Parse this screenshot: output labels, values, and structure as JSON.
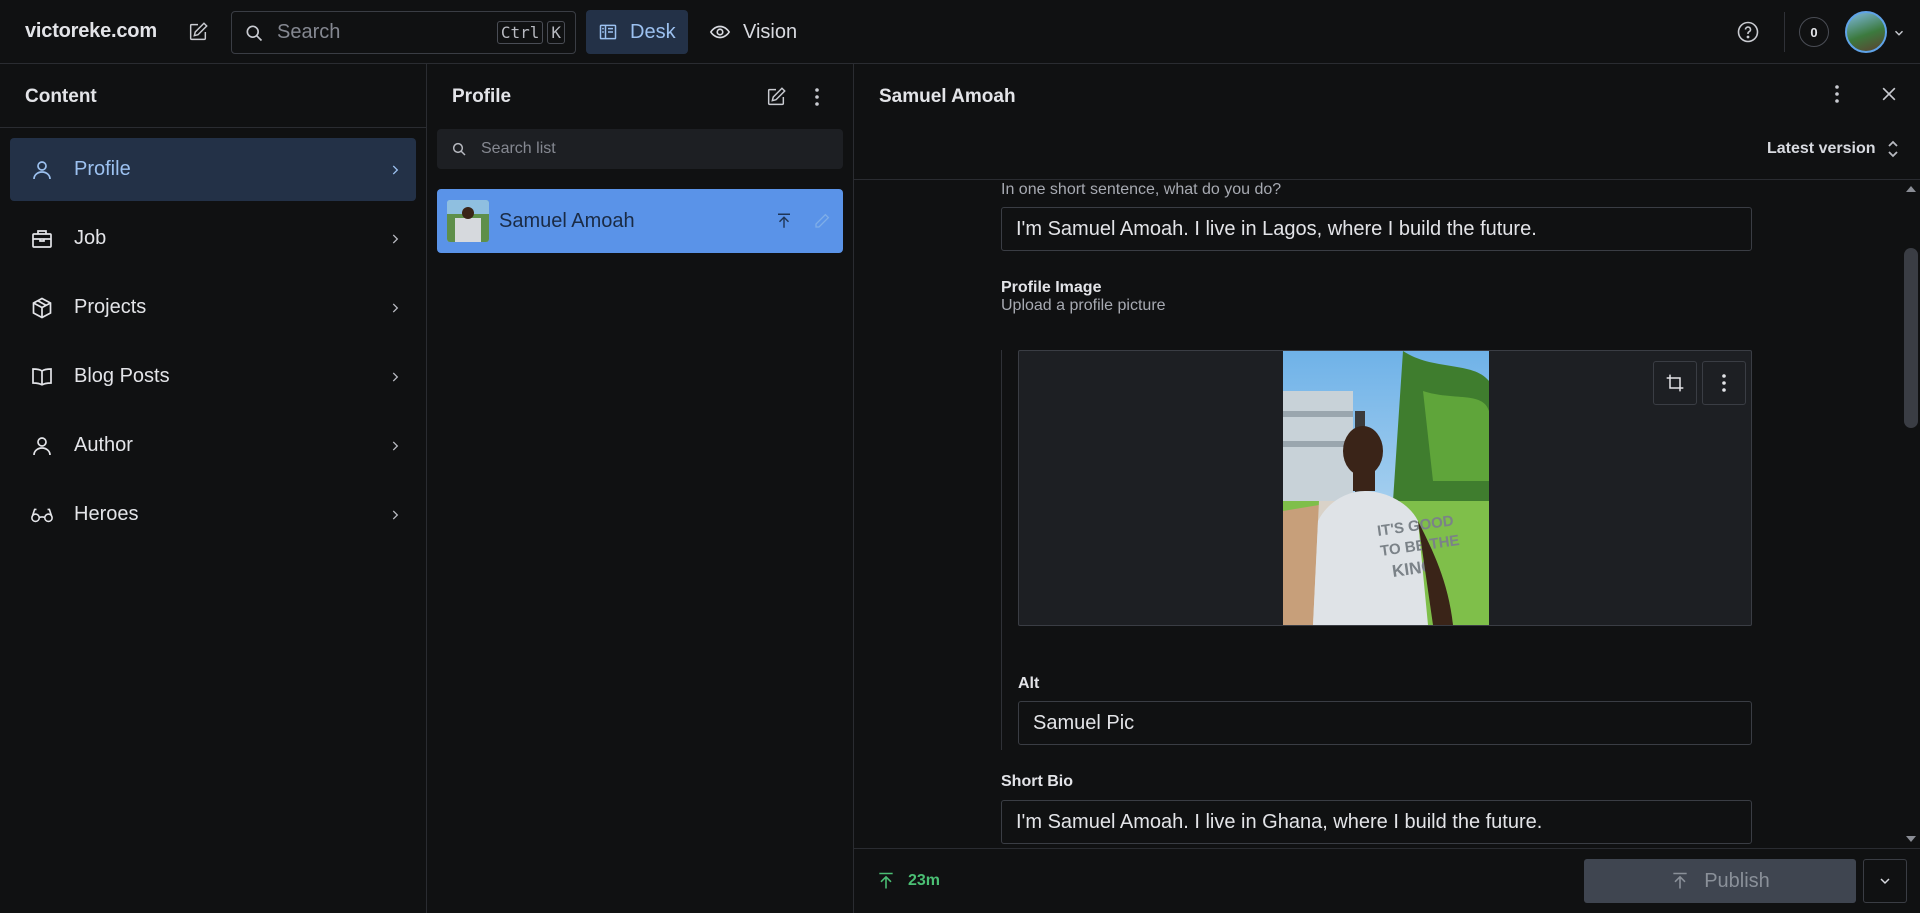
{
  "topbar": {
    "brand": "victoreke.com",
    "search_placeholder": "Search",
    "shortcut_keys": [
      "Ctrl",
      "K"
    ],
    "tools": [
      {
        "label": "Desk",
        "icon": "desk-icon",
        "active": true
      },
      {
        "label": "Vision",
        "icon": "eye-icon",
        "active": false
      }
    ],
    "notification_count": "0"
  },
  "sidebar": {
    "title": "Content",
    "items": [
      {
        "label": "Profile",
        "icon": "user-icon",
        "active": true
      },
      {
        "label": "Job",
        "icon": "briefcase-icon",
        "active": false
      },
      {
        "label": "Projects",
        "icon": "package-icon",
        "active": false
      },
      {
        "label": "Blog Posts",
        "icon": "book-icon",
        "active": false
      },
      {
        "label": "Author",
        "icon": "user-icon",
        "active": false
      },
      {
        "label": "Heroes",
        "icon": "glasses-icon",
        "active": false
      }
    ]
  },
  "list": {
    "title": "Profile",
    "search_placeholder": "Search list",
    "items": [
      {
        "label": "Samuel Amoah",
        "selected": true
      }
    ]
  },
  "document": {
    "title": "Samuel Amoah",
    "version_label": "Latest version",
    "headline_description": "In one short sentence, what do you do?",
    "headline_value": "I'm Samuel Amoah. I live in Lagos, where I build the future.",
    "profile_image_label": "Profile Image",
    "profile_image_description": "Upload a profile picture",
    "alt_label": "Alt",
    "alt_value": "Samuel Pic",
    "short_bio_label": "Short Bio",
    "short_bio_value": "I'm Samuel Amoah. I live in Ghana, where I build the future."
  },
  "footer": {
    "status_time": "23m",
    "publish_label": "Publish"
  },
  "colors": {
    "accent": "#5a93e8",
    "active_nav_bg": "#233147",
    "active_nav_text": "#9cc1f0",
    "published_green": "#4bbf74",
    "background": "#101112"
  }
}
